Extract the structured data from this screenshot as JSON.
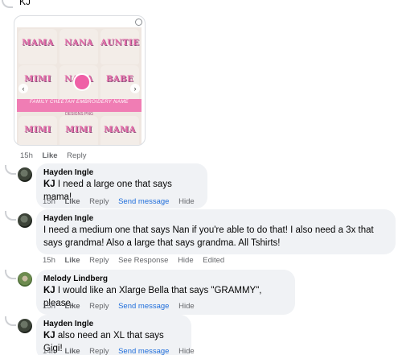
{
  "top_comment": {
    "mention": "KJ",
    "image_shirt_labels": [
      "MAMA",
      "NANA",
      "AUNTIE",
      "MIMI",
      "NANA",
      "BABE",
      "MIMI",
      "MIMI",
      "MAMA"
    ],
    "image_banner": "FAMILY CHEETAH EMBROIDERY NAME",
    "image_sub": "DESIGNS PNG",
    "time": "15h",
    "like": "Like",
    "reply": "Reply"
  },
  "replies": [
    {
      "author": "Hayden Ingle",
      "mention": "KJ",
      "text": " I need a large one that says mama!",
      "actions": {
        "time": "15h",
        "like": "Like",
        "reply": "Reply",
        "send": "Send message",
        "hide": "Hide"
      }
    },
    {
      "author": "Hayden Ingle",
      "line1": "I need a medium one that says Nan if you're able to do that! I also need a 3x that",
      "line2": "says grandma! Also a large that says grandma. All Tshirts!",
      "actions": {
        "time": "15h",
        "like": "Like",
        "reply": "Reply",
        "see": "See Response",
        "hide": "Hide",
        "edited": "Edited"
      }
    },
    {
      "author": "Melody Lindberg",
      "mention": "KJ",
      "text": " I would like an Xlarge Bella that says \"GRAMMY\", please.",
      "actions": {
        "time": "15h",
        "like": "Like",
        "reply": "Reply",
        "send": "Send message",
        "hide": "Hide"
      }
    },
    {
      "author": "Hayden Ingle",
      "mention": "KJ",
      "text": " also need an XL that says Gigi!",
      "actions": {
        "time": "14h",
        "like": "Like",
        "reply": "Reply",
        "send": "Send message",
        "hide": "Hide"
      }
    }
  ]
}
